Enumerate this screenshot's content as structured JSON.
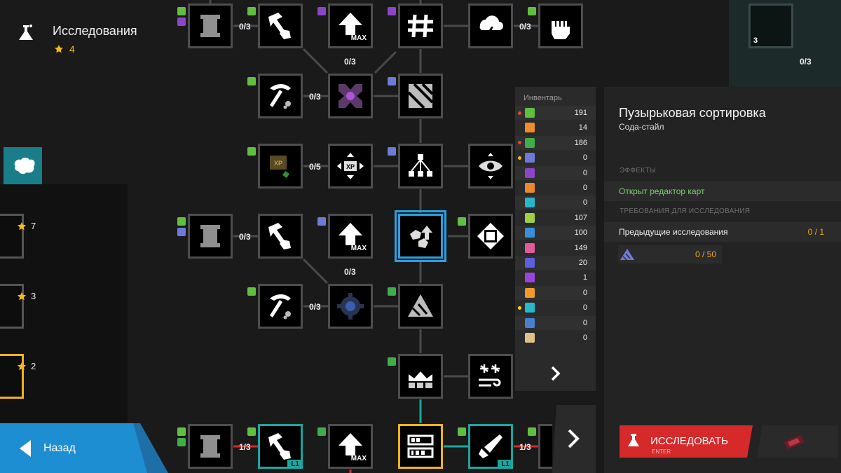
{
  "header": {
    "title": "Исследования",
    "stars": "4"
  },
  "side_tiers": [
    {
      "stars": "7"
    },
    {
      "stars": "3"
    },
    {
      "stars": "2"
    }
  ],
  "back_label": "Назад",
  "tree_counts": {
    "r1_a": "0/3",
    "r1_b": "0/3",
    "r1_max_up": "0/3",
    "r2_a": "0/3",
    "r3_a": "0/5",
    "r4_a": "0/3",
    "r4_max_up": "0/3",
    "r5_a": "0/3",
    "r7_a": "1/3",
    "r7_b": "1/3",
    "far_right": "0/3"
  },
  "node_labels": {
    "max": "MAX",
    "xp": "XP",
    "lvl": "L1",
    "three": "3"
  },
  "inventory": {
    "title": "Инвентарь",
    "items": [
      {
        "icon": "green-gear-resource-icon",
        "color": "#5fbf3f",
        "dot": "#e0462f",
        "value": "191"
      },
      {
        "icon": "orange-pentagon-resource-icon",
        "color": "#f08a2a",
        "dot": "",
        "value": "14"
      },
      {
        "icon": "green-circle-resource-icon",
        "color": "#3fae4a",
        "dot": "#e0462f",
        "value": "186"
      },
      {
        "icon": "blue-triangle-resource-icon",
        "color": "#6f7ad8",
        "dot": "#f4b820",
        "value": "0"
      },
      {
        "icon": "purple-stripe-resource-icon",
        "color": "#8d45c8",
        "dot": "",
        "value": "0"
      },
      {
        "icon": "orange-ball-resource-icon",
        "color": "#e88a2c",
        "dot": "",
        "value": "0"
      },
      {
        "icon": "cyan-stripe-resource-icon",
        "color": "#29b6c9",
        "dot": "",
        "value": "0"
      },
      {
        "icon": "lime-card-resource-icon",
        "color": "#9ed13e",
        "dot": "",
        "value": "107"
      },
      {
        "icon": "blue-card-resource-icon",
        "color": "#3a8fd8",
        "dot": "",
        "value": "100"
      },
      {
        "icon": "pink-card-resource-icon",
        "color": "#e05a9a",
        "dot": "",
        "value": "149"
      },
      {
        "icon": "indigo-card-resource-icon",
        "color": "#5b5fe0",
        "dot": "",
        "value": "20"
      },
      {
        "icon": "violet-card-resource-icon",
        "color": "#9a44e0",
        "dot": "",
        "value": "1"
      },
      {
        "icon": "amber-card-resource-icon",
        "color": "#f09a2a",
        "dot": "",
        "value": "0"
      },
      {
        "icon": "teal-card-resource-icon",
        "color": "#26b8d0",
        "dot": "#f4d020",
        "value": "0"
      },
      {
        "icon": "steel-card-resource-icon",
        "color": "#4a7fd0",
        "dot": "",
        "value": "0"
      },
      {
        "icon": "brush-resource-icon",
        "color": "#e0c08a",
        "dot": "",
        "value": "0"
      }
    ]
  },
  "details": {
    "title": "Пузырьковая сортировка",
    "subtitle": "Сода-стайл",
    "effects_header": "ЭФФЕКТЫ",
    "effect": "Открыт редактор карт",
    "requirements_header": "ТРЕБОВАНИЯ ДЛЯ ИССЛЕДОВАНИЯ",
    "prev_label": "Предыдущие исследования",
    "prev_value": "0 / 1",
    "resource_value": "0 / 50"
  },
  "research_button": {
    "label": "ИССЛЕДОВАТЬ",
    "hint": "ENTER"
  },
  "colors": {
    "accent_blue": "#2c9fe0",
    "teal": "#1aa6a0",
    "gold": "#f1b318",
    "research_red": "#d62a2a",
    "back_blue": "#1e8ed2",
    "effect_green": "#7bd36f",
    "req_orange": "#f0a328"
  }
}
